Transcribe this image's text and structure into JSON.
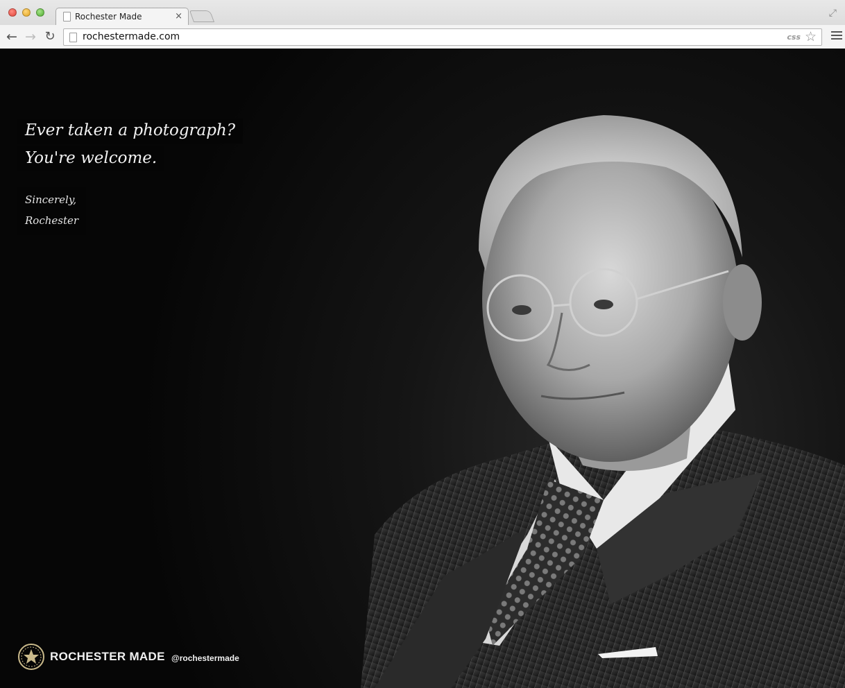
{
  "browser": {
    "tab_title": "Rochester Made",
    "tab_close": "×",
    "url": "rochestermade.com",
    "css_badge": "css",
    "back_glyph": "←",
    "forward_glyph": "→",
    "reload_glyph": "↻",
    "star_glyph": "☆",
    "fullscreen_glyph": "⤢"
  },
  "hero": {
    "headline": [
      "Ever taken a photograph?",
      "You're welcome."
    ],
    "signature": [
      "Sincerely,",
      "Rochester"
    ]
  },
  "footer": {
    "brand": "ROCHESTER MADE",
    "handle": "@rochestermade"
  },
  "icons": {
    "logo": "rochester-seal-icon",
    "page": "page-icon",
    "star": "star-icon",
    "menu": "hamburger-menu-icon"
  },
  "colors": {
    "page_background": "#000000",
    "text_box_background": "#050505",
    "text": "#f2f2f2",
    "logo_gold": "#c9b98a"
  }
}
